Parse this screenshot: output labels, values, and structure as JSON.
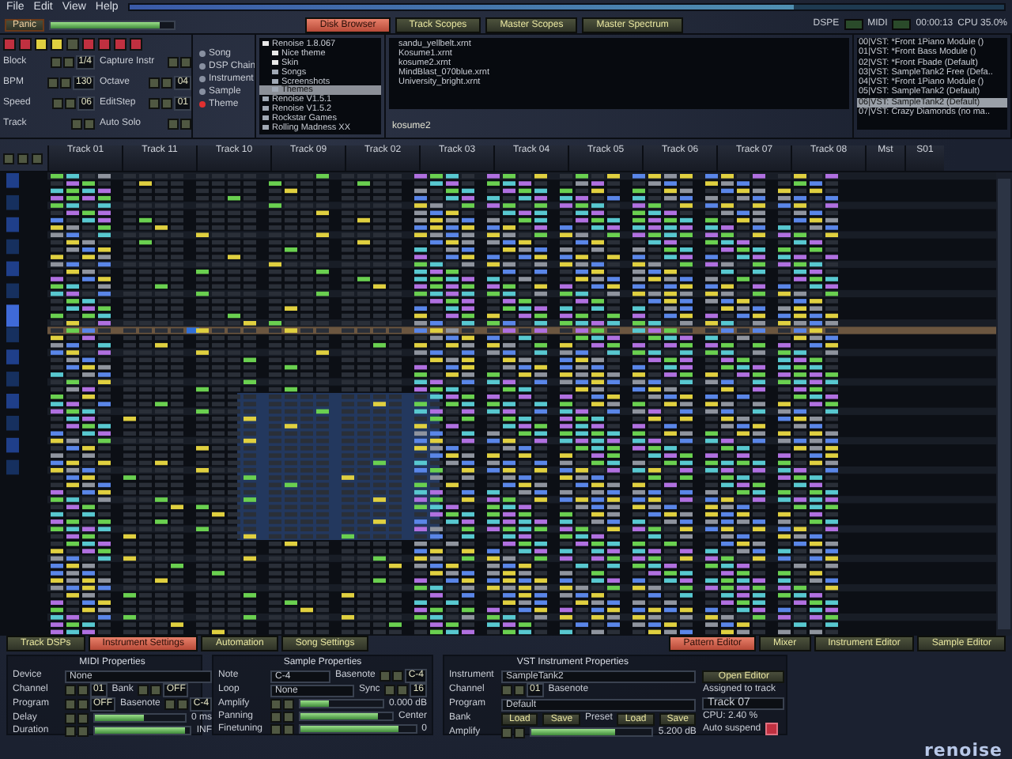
{
  "menu": [
    "File",
    "Edit",
    "View",
    "Help"
  ],
  "song_position": {
    "level": 0.76
  },
  "panic": "Panic",
  "master_volume": {
    "level": 0.88
  },
  "upper_tabs": [
    {
      "label": "Disk Browser",
      "selected": true
    },
    {
      "label": "Track Scopes",
      "selected": false
    },
    {
      "label": "Master Scopes",
      "selected": false
    },
    {
      "label": "Master Spectrum",
      "selected": false
    }
  ],
  "status": {
    "dsp": "DSPE",
    "midi": "MIDI",
    "time": "00:00:13",
    "cpu": "CPU 35.0%"
  },
  "controls": [
    {
      "label": "Block",
      "value": "1/4"
    },
    {
      "label": "Capture Instr"
    },
    {
      "label": "BPM",
      "value": "130"
    },
    {
      "label": "Octave",
      "value": "04"
    },
    {
      "label": "Speed",
      "value": "06"
    },
    {
      "label": "EditStep",
      "value": "01"
    },
    {
      "label": "Track"
    },
    {
      "label": "Auto Solo"
    }
  ],
  "browser_types": [
    {
      "label": "Song",
      "selected": false
    },
    {
      "label": "DSP Chain",
      "selected": false
    },
    {
      "label": "Instrument",
      "selected": false
    },
    {
      "label": "Sample",
      "selected": false
    },
    {
      "label": "Theme",
      "selected": true
    }
  ],
  "folders": [
    {
      "name": "Renoise 1.8.067",
      "selected": false,
      "expanded": true,
      "children": [
        {
          "name": "Nice theme",
          "selected": false,
          "expanded": true
        },
        {
          "name": "Skin",
          "selected": false,
          "expanded": true
        },
        {
          "name": "Songs",
          "selected": false,
          "expanded": false
        },
        {
          "name": "Screenshots",
          "selected": false,
          "expanded": false
        },
        {
          "name": "Themes",
          "selected": true,
          "expanded": false
        }
      ]
    },
    {
      "name": "Renoise V1.5.1",
      "selected": false,
      "expanded": false
    },
    {
      "name": "Renoise V1.5.2",
      "selected": false,
      "expanded": false
    },
    {
      "name": "Rockstar Games",
      "selected": false,
      "expanded": false
    },
    {
      "name": "Rolling Madness XX",
      "selected": false,
      "expanded": false
    }
  ],
  "files": [
    "sandu_yellbelt.xrnt",
    "Kosume1.xrnt",
    "kosume2.xrnt",
    "MindBlast_070blue.xrnt",
    "University_bright.xrnt"
  ],
  "filename": "kosume2",
  "instruments": [
    {
      "label": "00|VST: *Front 1Piano Module ()",
      "selected": false
    },
    {
      "label": "01|VST: *Front Bass Module ()",
      "selected": false
    },
    {
      "label": "02|VST: *Front Fbade (Default)",
      "selected": false
    },
    {
      "label": "03|VST: SampleTank2 Free (Defa..",
      "selected": false
    },
    {
      "label": "04|VST: *Front 1Piano Module ()",
      "selected": false
    },
    {
      "label": "05|VST: SampleTank2 (Default)",
      "selected": false
    },
    {
      "label": "06|VST: SampleTank2 (Default)",
      "selected": true
    },
    {
      "label": "07|VST: Crazy Diamonds (no ma..",
      "selected": false
    }
  ],
  "tracks": [
    "Track 01",
    "Track 11",
    "Track 10",
    "Track 09",
    "Track 02",
    "Track 03",
    "Track 04",
    "Track 05",
    "Track 06",
    "Track 07",
    "Track 08",
    "Mst",
    "S01"
  ],
  "lower_tabs_left": [
    {
      "label": "Track DSPs",
      "selected": false
    },
    {
      "label": "Instrument Settings",
      "selected": true
    },
    {
      "label": "Automation",
      "selected": false
    },
    {
      "label": "Song Settings",
      "selected": false
    }
  ],
  "lower_tabs_right": [
    {
      "label": "Pattern Editor",
      "selected": true
    },
    {
      "label": "Mixer",
      "selected": false
    },
    {
      "label": "Instrument Editor",
      "selected": false
    },
    {
      "label": "Sample Editor",
      "selected": false
    }
  ],
  "midi_properties": {
    "title": "MIDI Properties",
    "rows": [
      {
        "label": "Device",
        "select": "None"
      },
      {
        "label": "Channel",
        "spin": "01",
        "label2": "Bank",
        "spin2": "OFF"
      },
      {
        "label": "Program",
        "spin": "OFF",
        "label2": "Basenote",
        "spin2": "C-4"
      },
      {
        "label": "Delay",
        "level": 0.55,
        "reading": "0 ms"
      },
      {
        "label": "Duration",
        "level": 0.95,
        "reading": "INF"
      }
    ]
  },
  "sample_properties": {
    "title": "Sample Properties",
    "rows": [
      {
        "label": "Note",
        "select": "C-4",
        "label2": "Basenote",
        "spin2": "C-4"
      },
      {
        "label": "Loop",
        "select": "None",
        "label2": "Sync",
        "spin2": "16"
      },
      {
        "label": "Amplify",
        "level": 0.35,
        "reading": "0.000 dB"
      },
      {
        "label": "Panning",
        "level": 0.85,
        "reading": "Center"
      },
      {
        "label": "Finetuning",
        "level": 0.85,
        "reading": "0"
      }
    ]
  },
  "vst_properties": {
    "title": "VST Instrument Properties",
    "rows": [
      {
        "label": "Instrument",
        "select": "SampleTank2"
      },
      {
        "label": "Channel",
        "spin": "01",
        "label2": "Basenote"
      },
      {
        "label": "Program",
        "select": "Default"
      },
      {
        "label": "Bank",
        "buttons": [
          "Load",
          "Save"
        ],
        "label2": "Preset",
        "buttons2": [
          "Load",
          "Save"
        ]
      },
      {
        "label": "Amplify",
        "level": 0.7,
        "reading": "5.200 dB"
      }
    ],
    "side": {
      "button": "Open Editor",
      "assigned": "Assigned to track",
      "track": "Track 07",
      "cpu": "CPU: 2.40 %",
      "auto_suspend": "Auto suspend",
      "checked": true
    }
  },
  "logo": "renoise"
}
